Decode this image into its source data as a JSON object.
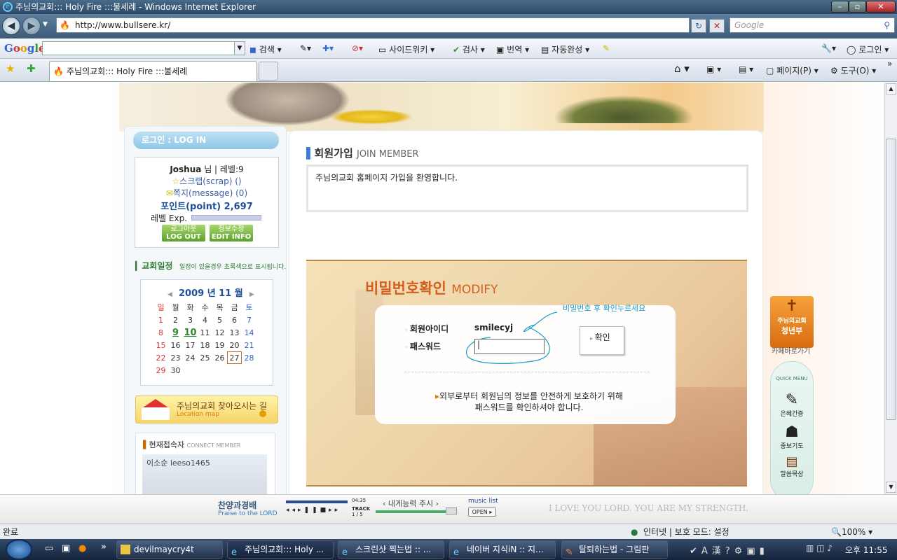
{
  "window": {
    "title": "주님의교회::: Holy Fire :::불세례 - Windows Internet Explorer"
  },
  "address": {
    "url": "http://www.bullsere.kr/",
    "search_placeholder": "Google"
  },
  "google_toolbar": {
    "logo": "Google",
    "items": [
      "검색",
      "사이드위키",
      "검사",
      "번역",
      "자동완성",
      "로그인"
    ]
  },
  "tab": {
    "title": "주님의교회::: Holy Fire :::불세례"
  },
  "command_bar": {
    "page": "페이지(P)",
    "tools": "도구(O)"
  },
  "sidebar": {
    "login_title": "로그인 : LOG IN",
    "user": "Joshua",
    "user_suffix": "님 | 레벨:9",
    "scrap": "스크랩(scrap)  ()",
    "message": "쪽지(message) (0)",
    "point": "포인트(point) 2,697",
    "level_label": "레벨 Exp.",
    "logout_btn": "로그아웃",
    "logout_sub": "LOG OUT",
    "edit_btn": "정보수정",
    "edit_sub": "EDIT INFO",
    "schedule_title": "교회일정",
    "schedule_note": "일정이 있을경우 초록색으로 표시됩니다.",
    "calendar_title": "2009 년 11 월",
    "weekdays": [
      "일",
      "월",
      "화",
      "수",
      "목",
      "금",
      "토"
    ],
    "weeks": [
      [
        "1",
        "2",
        "3",
        "4",
        "5",
        "6",
        "7"
      ],
      [
        "8",
        "9",
        "10",
        "11",
        "12",
        "13",
        "14"
      ],
      [
        "15",
        "16",
        "17",
        "18",
        "19",
        "20",
        "21"
      ],
      [
        "22",
        "23",
        "24",
        "25",
        "26",
        "27",
        "28"
      ],
      [
        "29",
        "30",
        "",
        "",
        "",
        "",
        ""
      ]
    ],
    "location_text": "주님의교회 찾아오시는 길",
    "location_sub": "Location map",
    "connect_title": "현재접속자",
    "connect_sub": "CONNECT MEMBER",
    "connect_user": "이소순 leeso1465"
  },
  "main": {
    "title": "회원가입",
    "title_en": "JOIN MEMBER",
    "welcome": "주님의교회 홈페이지 가입을 환영합니다.",
    "modify_title": "비밀번호확인",
    "modify_en": "MODIFY",
    "annotation": "비밀번호 후 확인누르세요",
    "id_label": "회원아이디",
    "id_value": "smilecyj",
    "pw_label": "패스워드",
    "confirm": "확인",
    "notice_line1": "외부로부터 회원님의 정보를 안전하게 보호하기 위해",
    "notice_line2": "패스워드를 확인하셔야 합니다."
  },
  "right_menu": {
    "cafe_line1": "주님의교회",
    "cafe_line2": "청년부",
    "cafe_link": "카페바로가기",
    "quick": "QUICK MENU",
    "items": [
      "은혜간증",
      "중보기도",
      "말씀묵상"
    ]
  },
  "music": {
    "title": "찬양과경배",
    "sub": "Praise to the LORD",
    "time": "04:35",
    "track_label": "TRACK",
    "track": "1 / 5",
    "song": "내게능력 주시",
    "list": "music list",
    "open": "OPEN",
    "motto": "I LOVE YOU LORD. YOU ARE MY STRENGTH."
  },
  "status": {
    "left": "완료",
    "zone": "인터넷 | 보호 모드: 설정",
    "zoom": "100%"
  },
  "taskbar": {
    "items": [
      "devilmaycry4t",
      "주님의교회::: Holy ...",
      "스크린샷 찍는법 :: ...",
      "네이버 지식iN :: 지...",
      "탈퇴하는법 - 그림판"
    ],
    "clock": "오후 11:55"
  }
}
